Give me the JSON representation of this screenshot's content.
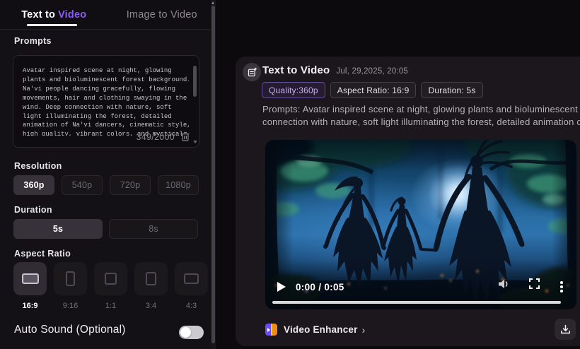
{
  "sidebar": {
    "tabs": {
      "text_to_video_prefix": "Text to",
      "text_to_video_accent": "Video",
      "image_to_video": "Image to Video"
    },
    "prompts": {
      "label": "Prompts",
      "lines": [
        "Avatar inspired scene at night, glowing",
        "plants and bioluminescent forest background.",
        "Na'vi people dancing gracefully, flowing",
        "movements, hair and clothing swaying in the",
        "wind. Deep connection with nature, soft",
        "light illuminating the forest, detailed",
        "animation of Na'vi dancers, cinematic style,",
        "high quality, vibrant colors, and mystical"
      ],
      "char_counter": "349/2000"
    },
    "resolution": {
      "label": "Resolution",
      "options": [
        "360p",
        "540p",
        "720p",
        "1080p"
      ],
      "selected": "360p"
    },
    "duration": {
      "label": "Duration",
      "options": [
        "5s",
        "8s"
      ],
      "selected": "5s"
    },
    "aspect_ratio": {
      "label": "Aspect Ratio",
      "options": [
        "16:9",
        "9:16",
        "1:1",
        "3:4",
        "4:3"
      ],
      "selected": "16:9"
    },
    "auto_sound": {
      "label": "Auto Sound (Optional)",
      "state": "off"
    }
  },
  "result": {
    "title": "Text to Video",
    "timestamp": "Jul, 29,2025, 20:05",
    "badges": {
      "quality": "Quality:360p",
      "aspect_ratio": "Aspect Ratio: 16:9",
      "duration": "Duration: 5s"
    },
    "prompt_line1": "Prompts:  Avatar inspired scene at night, glowing plants and bioluminescent f",
    "prompt_line2": "connection with nature, soft light illuminating the forest, detailed animation o",
    "video": {
      "time_label": "0:00 / 0:05",
      "description": "Night bioluminescent forest, three Na'vi dancers holding hands in blue moonlit glade"
    },
    "enhancer_label": "Video Enhancer",
    "enhancer_chevron": "›"
  },
  "icons": {
    "note": "document-plus-icon",
    "trash": "trash-icon",
    "play": "play-icon",
    "volume": "volume-icon",
    "fullscreen": "fullscreen-icon",
    "kebab": "kebab-menu-icon",
    "enhancer": "video-enhancer-icon",
    "download": "download-icon"
  },
  "colors": {
    "accent": "#8b5cf6",
    "badge_accent_text": "#c6aef2",
    "sidebar_bg": "#141116",
    "card_bg": "#1b171c",
    "page_bg": "#0c0a0d"
  }
}
